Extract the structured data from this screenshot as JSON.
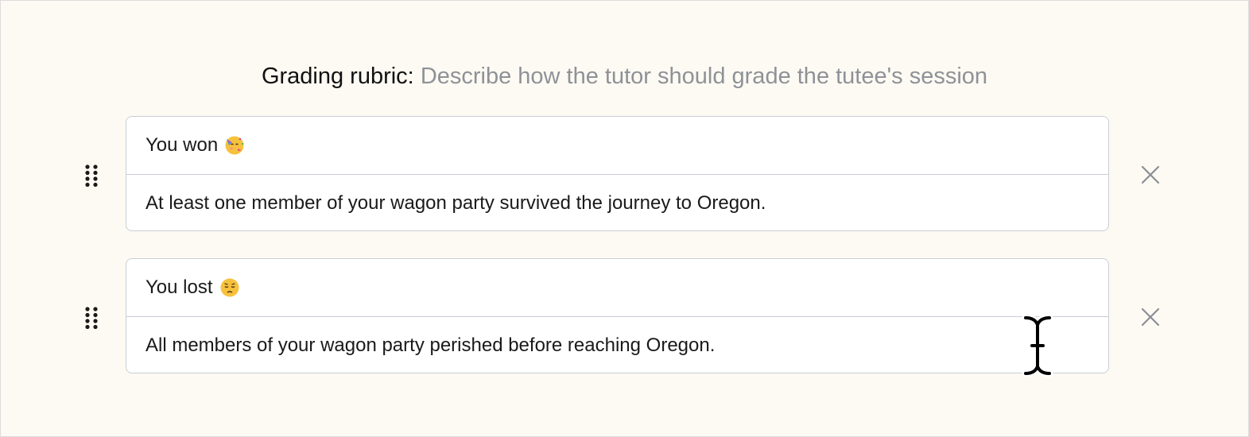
{
  "heading": {
    "label": "Grading rubric:",
    "hint": "Describe how the tutor should grade the tutee's session"
  },
  "rubrics": [
    {
      "title": "You won",
      "emoji": "partying-face-emoji",
      "description": "At least one member of your wagon party survived the journey to Oregon."
    },
    {
      "title": "You lost",
      "emoji": "pensive-face-emoji",
      "description": "All members of your wagon party perished before reaching Oregon."
    }
  ],
  "icons": {
    "drag": "drag-handle-icon",
    "remove": "close-icon",
    "cursor": "text-cursor-icon"
  },
  "colors": {
    "background": "#fdfaf3",
    "card_border": "#c9ced6",
    "hint_text": "#8e9297",
    "icon_gray": "#8a8f96"
  }
}
